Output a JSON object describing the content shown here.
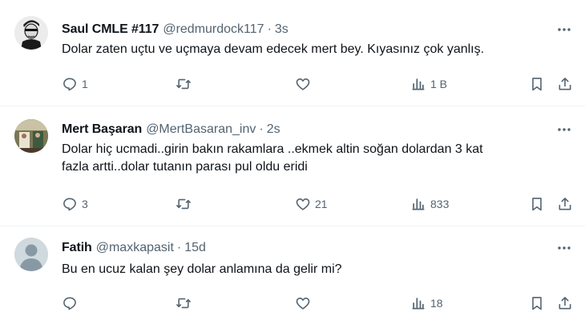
{
  "tweets": [
    {
      "name": "Saul CMLE #117",
      "handle": "@redmurdock117",
      "time": "3s",
      "lines": [
        "Dolar zaten uçtu ve uçmaya devam edecek mert bey. Kıyasınız çok yanlış."
      ],
      "replies": "1",
      "retweets": "",
      "likes": "",
      "views": "1 B",
      "avatar_icon": "cartoon-portrait-avatar"
    },
    {
      "name": "Mert Başaran",
      "handle": "@MertBasaran_inv",
      "time": "2s",
      "lines": [
        "Dolar hiç ucmadi..girin bakın rakamlara ..ekmek altin soğan dolardan 3 kat",
        "fazla artti..dolar tutanın parası pul oldu eridi"
      ],
      "replies": "3",
      "retweets": "",
      "likes": "21",
      "views": "833",
      "avatar_icon": "photo-avatar"
    },
    {
      "name": "Fatih",
      "handle": "@maxkapasit",
      "time": "15d",
      "lines": [
        "Bu en ucuz kalan şey dolar anlamına da gelir mi?"
      ],
      "replies": "",
      "retweets": "",
      "likes": "",
      "views": "18",
      "avatar_icon": "default-person-avatar"
    }
  ],
  "separator": "·",
  "colors": {
    "text": "#0f1419",
    "secondary": "#536471",
    "divider": "#eff3f4"
  }
}
